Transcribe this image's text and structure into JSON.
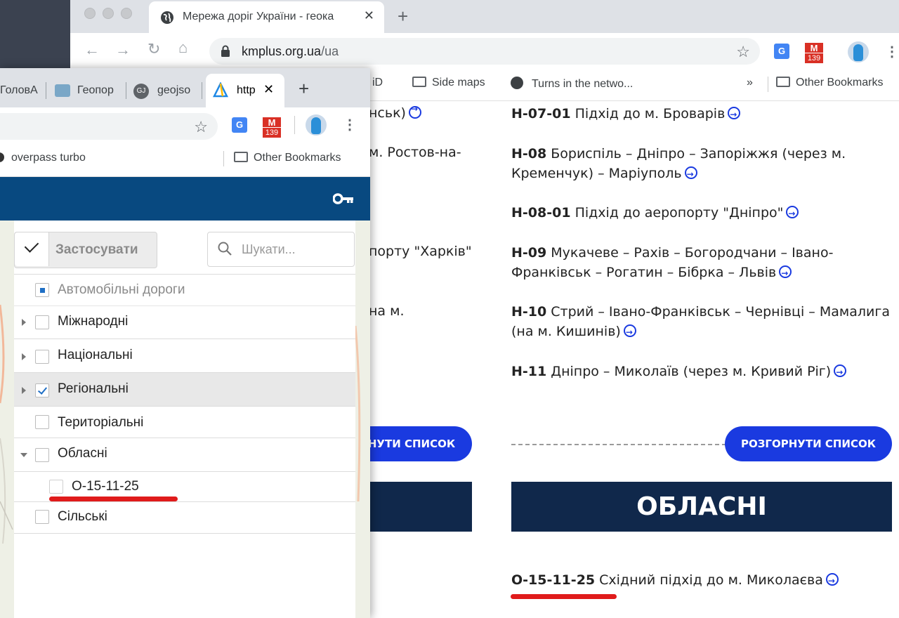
{
  "back_window": {
    "tab_title": "Мережа доріг України - геока",
    "url_host": "kmplus.org.ua",
    "url_path": "/ua",
    "gmail_count": "139",
    "bookmarks": [
      "iD",
      "Side maps",
      "Turns in the netwo..."
    ],
    "bookmarks_more": "»",
    "other_bookmarks": "Other Bookmarks"
  },
  "page": {
    "left_fragments": [
      "нськ)",
      "м. Ростов-на-",
      "порту \"Харків\"",
      "на м."
    ],
    "roads": [
      {
        "code": "Н-07-01",
        "name": "Підхід до м. Броварів"
      },
      {
        "code": "Н-08",
        "name": "Бориспіль – Дніпро – Запоріжжя (через м. Кременчук) – Маріуполь"
      },
      {
        "code": "Н-08-01",
        "name": "Підхід до аеропорту \"Дніпро\""
      },
      {
        "code": "Н-09",
        "name": "Мукачеве – Рахів – Богородчани – Івано-Франківськ – Рогатин – Бібрка – Львів"
      },
      {
        "code": "Н-10",
        "name": "Стрий – Івано-Франківськ – Чернівці – Мамалига (на м. Кишинів)"
      },
      {
        "code": "Н-11",
        "name": "Дніпро – Миколаїв (через м. Кривий Ріг)"
      }
    ],
    "expand_left_partial": "НУТИ СПИСОК",
    "expand_button": "РОЗГОРНУТИ СПИСОК",
    "section_title": "ОБЛАСНІ",
    "oblast_road": {
      "code": "О-15-11-25",
      "name": "Східний підхід до м. Миколаєва"
    }
  },
  "front_window": {
    "tabs": [
      "ГоловА",
      "Геопор",
      "geojso",
      "http"
    ],
    "gmail_count": "139",
    "bookmarks": [
      "overpass turbo"
    ],
    "other_bookmarks": "Other Bookmarks",
    "key_icon": "key-icon"
  },
  "layer_panel": {
    "apply_label": "Застосувати",
    "search_placeholder": "Шукати...",
    "root_layer": "Автомобільні дороги",
    "layers": [
      {
        "label": "Міжнародні",
        "checked": false,
        "expand": "collapsed"
      },
      {
        "label": "Національні",
        "checked": false,
        "expand": "collapsed"
      },
      {
        "label": "Регіональні",
        "checked": true,
        "expand": "collapsed"
      },
      {
        "label": "Територіальні",
        "checked": false,
        "expand": "none"
      },
      {
        "label": "Обласні",
        "checked": false,
        "expand": "expanded"
      },
      {
        "label": "О-15-11-25",
        "checked": false,
        "expand": "child"
      },
      {
        "label": "Сільські",
        "checked": false,
        "expand": "none"
      }
    ]
  },
  "colors": {
    "accent_blue": "#1a3ae0",
    "banner_navy": "#10284b",
    "header_blue": "#084980",
    "highlight_red": "#e01b1b"
  }
}
